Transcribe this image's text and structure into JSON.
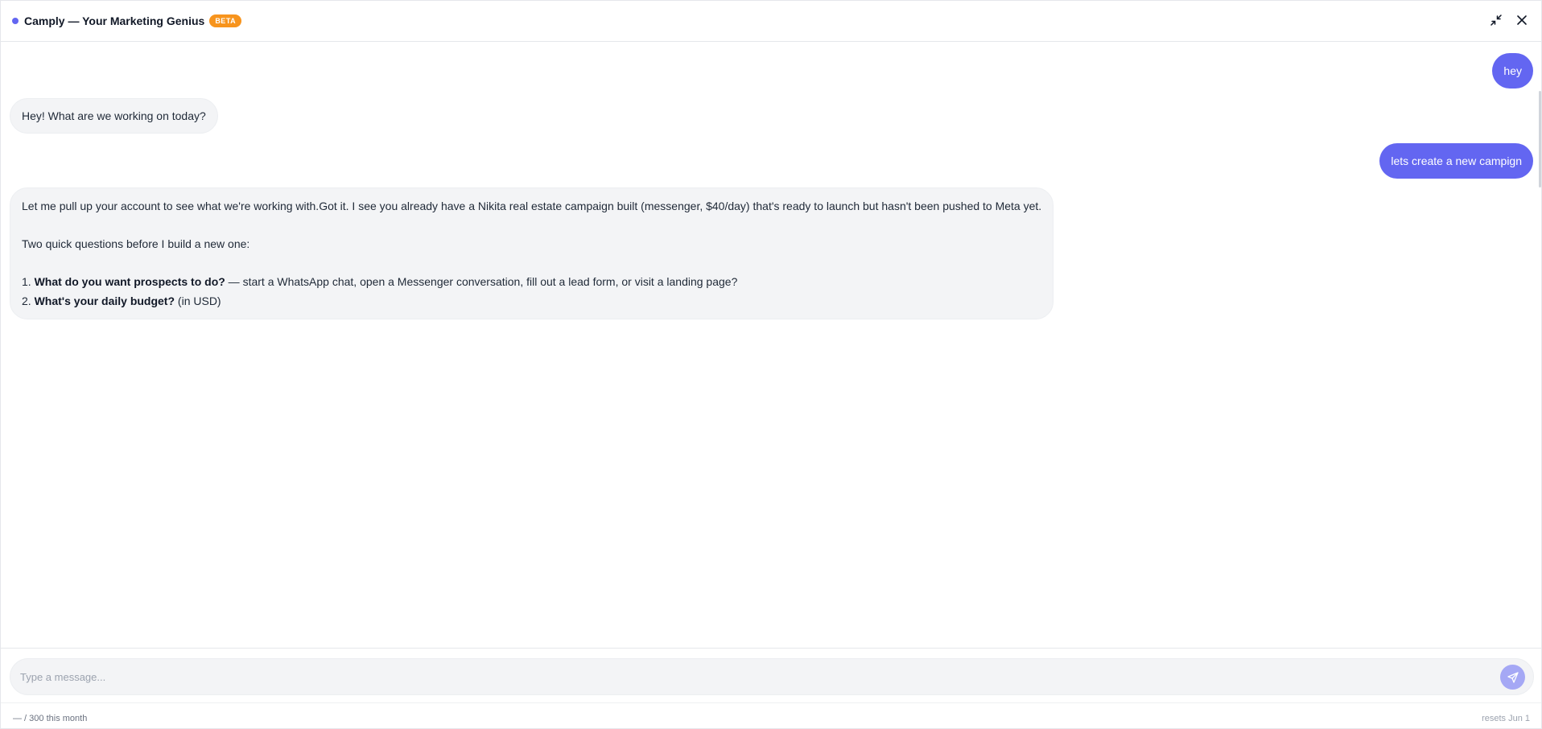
{
  "header": {
    "title": "Camply — Your Marketing Genius",
    "badge": "BETA",
    "status_color": "#6366f1",
    "badge_color": "#f7941d",
    "actions": [
      {
        "name": "collapse",
        "icon": "collapse-arrows-icon"
      },
      {
        "name": "close",
        "icon": "close-icon"
      }
    ]
  },
  "conversation": {
    "messages": [
      {
        "role": "user",
        "text": "hey"
      },
      {
        "role": "assistant",
        "text": "Hey! What are we working on today?"
      },
      {
        "role": "user",
        "text": "lets create a new campign"
      },
      {
        "role": "assistant",
        "intro": "Let me pull up your account to see what we're working with.Got it. I see you already have a Nikita real estate campaign built (messenger, $40/day) that's ready to launch but hasn't been pushed to Meta yet.",
        "lead": "Two quick questions before I build a new one:",
        "questions": [
          {
            "num": "1.",
            "bold": "What do you want prospects to do?",
            "rest": " — start a WhatsApp chat, open a Messenger conversation, fill out a lead form, or visit a landing page?"
          },
          {
            "num": "2.",
            "bold": "What's your daily budget?",
            "rest": " (in USD)"
          }
        ]
      }
    ],
    "user_bubble_color": "#6366f1",
    "assistant_bubble_color": "#f3f4f6"
  },
  "composer": {
    "placeholder": "Type a message...",
    "value": "",
    "send_icon": "send-icon"
  },
  "footer": {
    "usage": "— / 300 this month",
    "reset": "resets Jun 1"
  }
}
